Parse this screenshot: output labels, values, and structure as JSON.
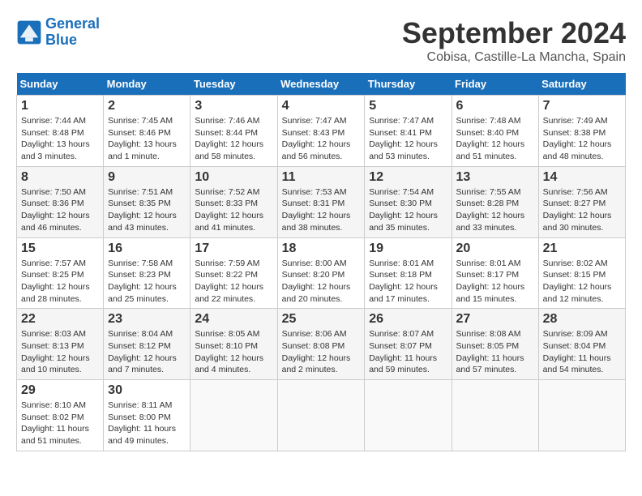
{
  "header": {
    "logo_line1": "General",
    "logo_line2": "Blue",
    "month": "September 2024",
    "location": "Cobisa, Castille-La Mancha, Spain"
  },
  "weekdays": [
    "Sunday",
    "Monday",
    "Tuesday",
    "Wednesday",
    "Thursday",
    "Friday",
    "Saturday"
  ],
  "weeks": [
    [
      {
        "day": "1",
        "info": "Sunrise: 7:44 AM\nSunset: 8:48 PM\nDaylight: 13 hours\nand 3 minutes."
      },
      {
        "day": "2",
        "info": "Sunrise: 7:45 AM\nSunset: 8:46 PM\nDaylight: 13 hours\nand 1 minute."
      },
      {
        "day": "3",
        "info": "Sunrise: 7:46 AM\nSunset: 8:44 PM\nDaylight: 12 hours\nand 58 minutes."
      },
      {
        "day": "4",
        "info": "Sunrise: 7:47 AM\nSunset: 8:43 PM\nDaylight: 12 hours\nand 56 minutes."
      },
      {
        "day": "5",
        "info": "Sunrise: 7:47 AM\nSunset: 8:41 PM\nDaylight: 12 hours\nand 53 minutes."
      },
      {
        "day": "6",
        "info": "Sunrise: 7:48 AM\nSunset: 8:40 PM\nDaylight: 12 hours\nand 51 minutes."
      },
      {
        "day": "7",
        "info": "Sunrise: 7:49 AM\nSunset: 8:38 PM\nDaylight: 12 hours\nand 48 minutes."
      }
    ],
    [
      {
        "day": "8",
        "info": "Sunrise: 7:50 AM\nSunset: 8:36 PM\nDaylight: 12 hours\nand 46 minutes."
      },
      {
        "day": "9",
        "info": "Sunrise: 7:51 AM\nSunset: 8:35 PM\nDaylight: 12 hours\nand 43 minutes."
      },
      {
        "day": "10",
        "info": "Sunrise: 7:52 AM\nSunset: 8:33 PM\nDaylight: 12 hours\nand 41 minutes."
      },
      {
        "day": "11",
        "info": "Sunrise: 7:53 AM\nSunset: 8:31 PM\nDaylight: 12 hours\nand 38 minutes."
      },
      {
        "day": "12",
        "info": "Sunrise: 7:54 AM\nSunset: 8:30 PM\nDaylight: 12 hours\nand 35 minutes."
      },
      {
        "day": "13",
        "info": "Sunrise: 7:55 AM\nSunset: 8:28 PM\nDaylight: 12 hours\nand 33 minutes."
      },
      {
        "day": "14",
        "info": "Sunrise: 7:56 AM\nSunset: 8:27 PM\nDaylight: 12 hours\nand 30 minutes."
      }
    ],
    [
      {
        "day": "15",
        "info": "Sunrise: 7:57 AM\nSunset: 8:25 PM\nDaylight: 12 hours\nand 28 minutes."
      },
      {
        "day": "16",
        "info": "Sunrise: 7:58 AM\nSunset: 8:23 PM\nDaylight: 12 hours\nand 25 minutes."
      },
      {
        "day": "17",
        "info": "Sunrise: 7:59 AM\nSunset: 8:22 PM\nDaylight: 12 hours\nand 22 minutes."
      },
      {
        "day": "18",
        "info": "Sunrise: 8:00 AM\nSunset: 8:20 PM\nDaylight: 12 hours\nand 20 minutes."
      },
      {
        "day": "19",
        "info": "Sunrise: 8:01 AM\nSunset: 8:18 PM\nDaylight: 12 hours\nand 17 minutes."
      },
      {
        "day": "20",
        "info": "Sunrise: 8:01 AM\nSunset: 8:17 PM\nDaylight: 12 hours\nand 15 minutes."
      },
      {
        "day": "21",
        "info": "Sunrise: 8:02 AM\nSunset: 8:15 PM\nDaylight: 12 hours\nand 12 minutes."
      }
    ],
    [
      {
        "day": "22",
        "info": "Sunrise: 8:03 AM\nSunset: 8:13 PM\nDaylight: 12 hours\nand 10 minutes."
      },
      {
        "day": "23",
        "info": "Sunrise: 8:04 AM\nSunset: 8:12 PM\nDaylight: 12 hours\nand 7 minutes."
      },
      {
        "day": "24",
        "info": "Sunrise: 8:05 AM\nSunset: 8:10 PM\nDaylight: 12 hours\nand 4 minutes."
      },
      {
        "day": "25",
        "info": "Sunrise: 8:06 AM\nSunset: 8:08 PM\nDaylight: 12 hours\nand 2 minutes."
      },
      {
        "day": "26",
        "info": "Sunrise: 8:07 AM\nSunset: 8:07 PM\nDaylight: 11 hours\nand 59 minutes."
      },
      {
        "day": "27",
        "info": "Sunrise: 8:08 AM\nSunset: 8:05 PM\nDaylight: 11 hours\nand 57 minutes."
      },
      {
        "day": "28",
        "info": "Sunrise: 8:09 AM\nSunset: 8:04 PM\nDaylight: 11 hours\nand 54 minutes."
      }
    ],
    [
      {
        "day": "29",
        "info": "Sunrise: 8:10 AM\nSunset: 8:02 PM\nDaylight: 11 hours\nand 51 minutes."
      },
      {
        "day": "30",
        "info": "Sunrise: 8:11 AM\nSunset: 8:00 PM\nDaylight: 11 hours\nand 49 minutes."
      },
      {
        "day": "",
        "info": ""
      },
      {
        "day": "",
        "info": ""
      },
      {
        "day": "",
        "info": ""
      },
      {
        "day": "",
        "info": ""
      },
      {
        "day": "",
        "info": ""
      }
    ]
  ]
}
